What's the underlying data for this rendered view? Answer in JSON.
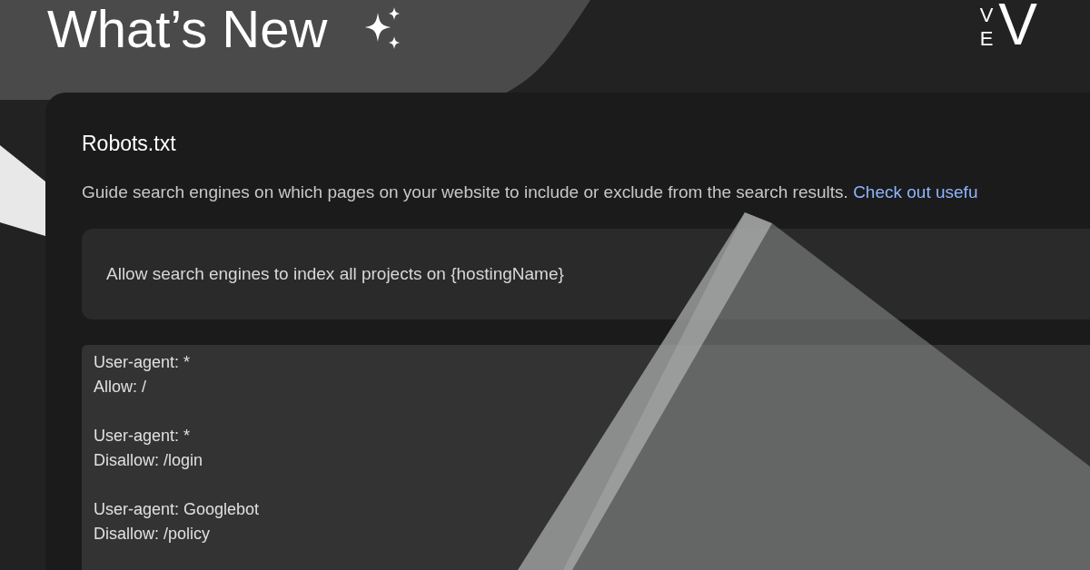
{
  "header": {
    "title": "What’s New"
  },
  "logo": {
    "small_top": "V",
    "small_bottom": "E",
    "large": "V"
  },
  "card": {
    "title": "Robots.txt",
    "description": "Guide search engines on which pages on your website to include or exclude from the search results.",
    "link": "Check out usefu",
    "option": {
      "label": "Allow search engines to index all projects on {hostingName}"
    },
    "code_blocks": [
      [
        "User-agent: *",
        "Allow: /"
      ],
      [
        "User-agent: *",
        "Disallow: /login"
      ],
      [
        "User-agent: Googlebot",
        "Disallow: /policy"
      ]
    ]
  }
}
